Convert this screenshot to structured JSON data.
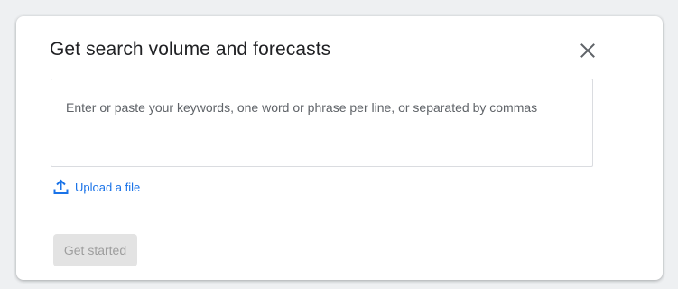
{
  "dialog": {
    "title": "Get search volume and forecasts",
    "close_icon": "close-icon",
    "keywords_input": {
      "value": "",
      "placeholder": "Enter or paste your keywords, one word or phrase per line, or separated by commas"
    },
    "upload": {
      "icon": "upload-icon",
      "label": "Upload a file"
    },
    "get_started_label": "Get started",
    "get_started_disabled": true
  },
  "colors": {
    "page_background": "#eef0f2",
    "dialog_background": "#ffffff",
    "title_text": "#202124",
    "link_blue": "#1a73e8",
    "disabled_button_bg": "#e3e3e3",
    "disabled_button_text": "#9e9e9e",
    "input_border": "#dadce0"
  }
}
